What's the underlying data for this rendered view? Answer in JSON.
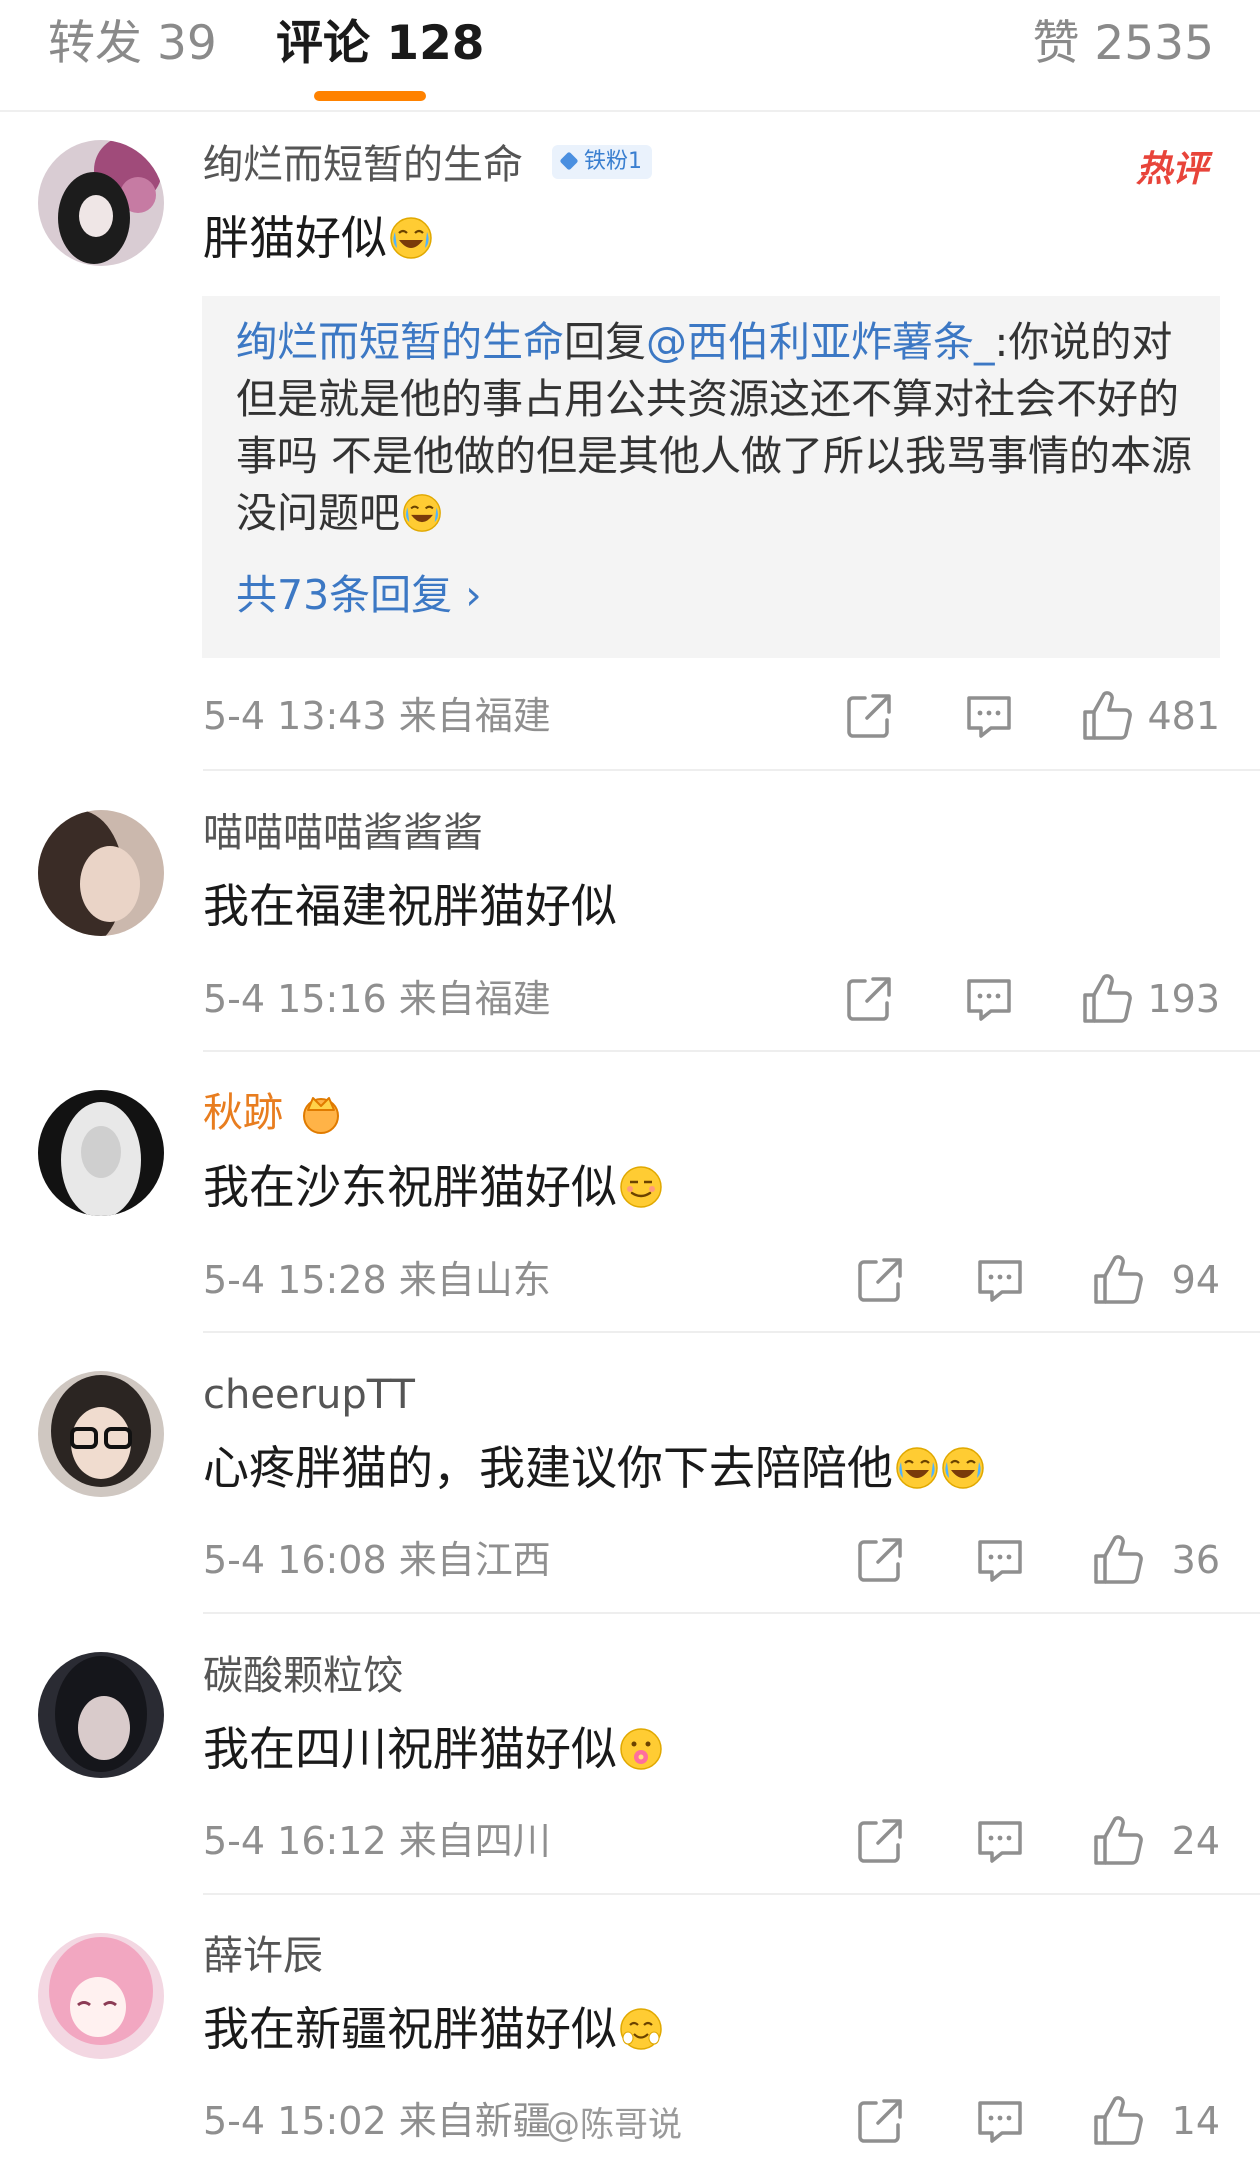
{
  "tabs": {
    "repost": "转发 39",
    "comments": "评论 128",
    "likes": "赞 2535"
  },
  "colors": {
    "accent": "#ff8200",
    "link": "#3c78c4",
    "hot": "#e8443a"
  },
  "comments": [
    {
      "username": "绚烂而短暂的生命",
      "badge": "铁粉1",
      "hot_label": "热评",
      "content": "胖猫好似",
      "emoji": "laugh-cry",
      "reply": {
        "from": "绚烂而短暂的生命",
        "verb": "回复",
        "to": "@西伯利亚炸薯条_",
        "text": ":你说的对 但是就是他的事占用公共资源这还不算对社会不好的事吗 不是他做的但是其他人做了所以我骂事情的本源没问题吧",
        "more": "共73条回复 ›"
      },
      "meta": "5-4 13:43  来自福建",
      "likes": "481"
    },
    {
      "username": "喵喵喵喵酱酱酱",
      "content": "我在福建祝胖猫好似",
      "meta": "5-4 15:16  来自福建",
      "likes": "193"
    },
    {
      "username": "秋跡",
      "content": "我在沙东祝胖猫好似",
      "emoji": "smirk",
      "meta": "5-4 15:28  来自山东",
      "likes": "94"
    },
    {
      "username": "cheerupTT",
      "content": "心疼胖猫的，我建议你下去陪陪他",
      "emoji": "laugh-cry x2",
      "meta": "5-4 16:08  来自江西",
      "likes": "36"
    },
    {
      "username": "碳酸颗粒饺",
      "content": "我在四川祝胖猫好似",
      "emoji": "flower-face",
      "meta": "5-4 16:12  来自四川",
      "likes": "24"
    },
    {
      "username": "薛许辰",
      "content": "我在新疆祝胖猫好似",
      "emoji": "blush",
      "meta": "5-4 15:02  来自新疆",
      "likes": "14"
    }
  ],
  "watermark": "@陈哥说"
}
